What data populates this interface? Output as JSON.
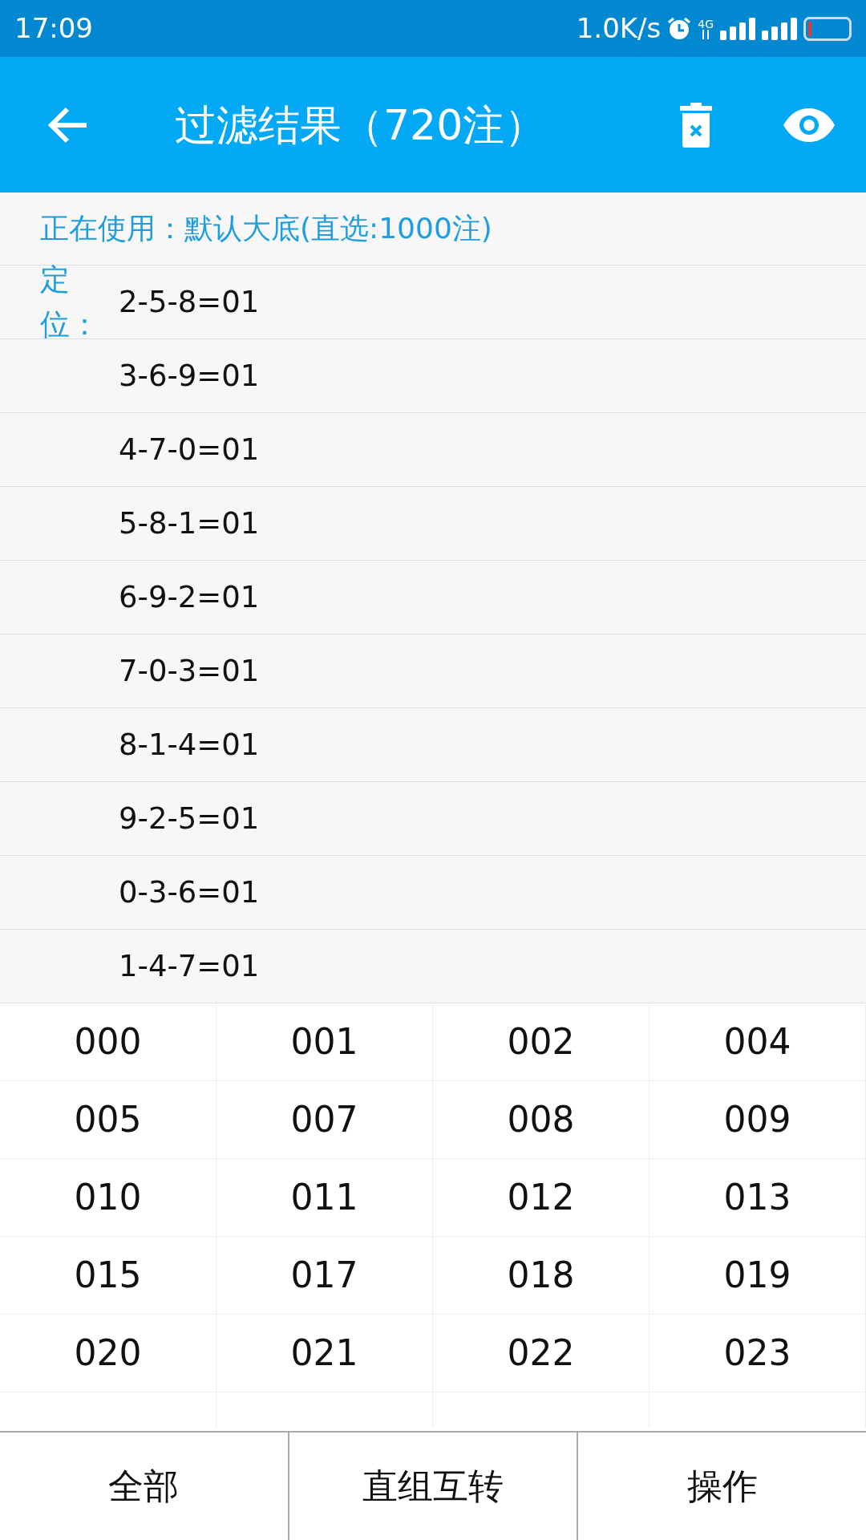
{
  "status_bar": {
    "time": "17:09",
    "speed": "1.0K/s",
    "network": "4G"
  },
  "app_bar": {
    "title": "过滤结果（720注）"
  },
  "usage": {
    "label": "正在使用：",
    "value": "默认大底(直选:1000注)"
  },
  "positioning": {
    "label": "定位：",
    "rules": [
      "2-5-8=01",
      "3-6-9=01",
      "4-7-0=01",
      "5-8-1=01",
      "6-9-2=01",
      "7-0-3=01",
      "8-1-4=01",
      "9-2-5=01",
      "0-3-6=01",
      "1-4-7=01"
    ]
  },
  "results": [
    "000",
    "001",
    "002",
    "004",
    "005",
    "007",
    "008",
    "009",
    "010",
    "011",
    "012",
    "013",
    "015",
    "017",
    "018",
    "019",
    "020",
    "021",
    "022",
    "023"
  ],
  "bottom_buttons": [
    "全部",
    "直组互转",
    "操作"
  ]
}
